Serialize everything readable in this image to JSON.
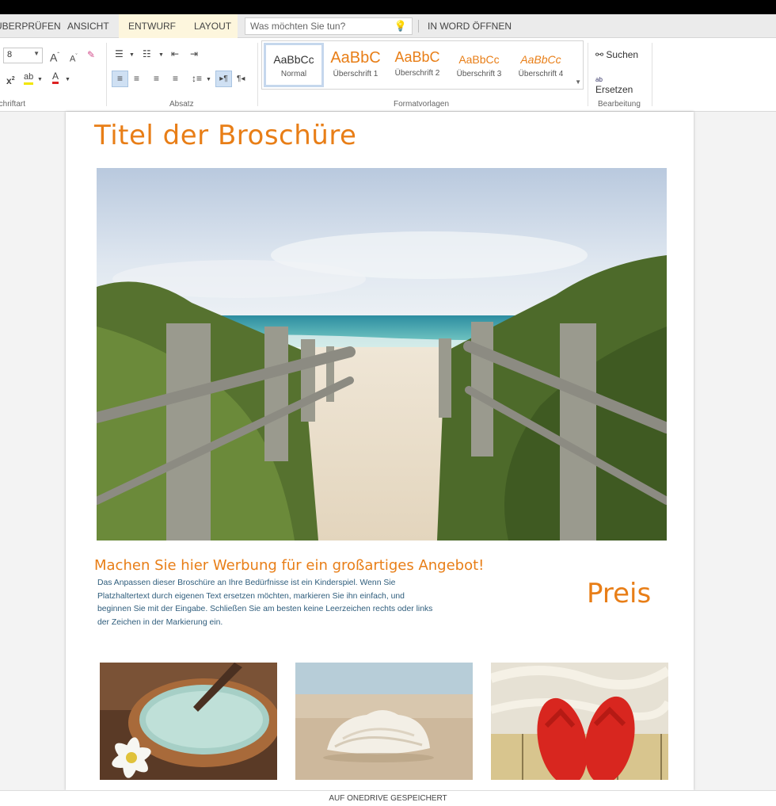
{
  "tabs": [
    {
      "label": "ÜBERPRÜFEN"
    },
    {
      "label": "ANSICHT"
    },
    {
      "label": "ENTWURF"
    },
    {
      "label": "LAYOUT"
    }
  ],
  "search": {
    "placeholder": "Was möchten Sie tun?"
  },
  "open_in_word": "IN WORD ÖFFNEN",
  "ribbon": {
    "font_size": "8",
    "groups": {
      "font": "Schriftart",
      "paragraph": "Absatz",
      "styles": "Formatvorlagen",
      "editing": "Bearbeitung"
    },
    "styles": [
      {
        "sample": "AaBbCc",
        "name": "Normal"
      },
      {
        "sample": "AaBbC",
        "name": "Überschrift 1"
      },
      {
        "sample": "AaBbC",
        "name": "Überschrift 2"
      },
      {
        "sample": "AaBbCc",
        "name": "Überschrift 3"
      },
      {
        "sample": "AaBbCc",
        "name": "Überschrift 4"
      }
    ],
    "find": "Suchen",
    "replace": "Ersetzen"
  },
  "document": {
    "title": "Titel der Broschüre",
    "promo_heading": "Machen Sie hier Werbung für ein großartiges Angebot!",
    "promo_body": "Das Anpassen dieser Broschüre an Ihre Bedürfnisse ist ein Kinderspiel. Wenn Sie Platzhaltertext durch eigenen Text ersetzen möchten, markieren Sie ihn einfach, und beginnen Sie mit der Eingabe. Schließen Sie am besten keine Leerzeichen rechts oder links der Zeichen in der Markierung ein.",
    "price": "Preis"
  },
  "status": "AUF ONEDRIVE GESPEICHERT",
  "colors": {
    "accent": "#e87e17",
    "body_text": "#2f5d7c"
  }
}
